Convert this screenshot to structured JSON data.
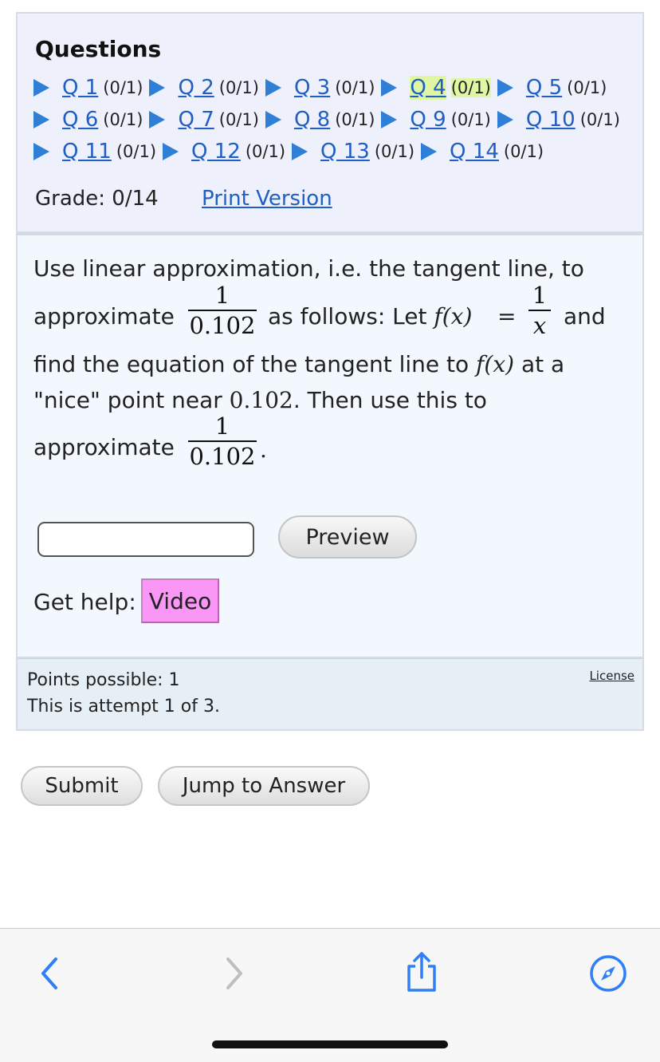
{
  "questions_panel": {
    "title": "Questions",
    "rows": [
      [
        {
          "label": "Q 1",
          "score": "(0/1)"
        },
        {
          "label": "Q 2",
          "score": "(0/1)"
        },
        {
          "label": "Q 3",
          "score": "(0/1)"
        },
        {
          "label": "Q 4",
          "score": "(0/1)",
          "current": true
        },
        {
          "label": "Q 5",
          "score": "(0/1)"
        }
      ],
      [
        {
          "label": "Q 6",
          "score": "(0/1)"
        },
        {
          "label": "Q 7",
          "score": "(0/1)"
        },
        {
          "label": "Q 8",
          "score": "(0/1)"
        },
        {
          "label": "Q 9",
          "score": "(0/1)"
        },
        {
          "label": "Q 10",
          "score": "(0/1)"
        }
      ],
      [
        {
          "label": "Q 11",
          "score": "(0/1)"
        },
        {
          "label": "Q 12",
          "score": "(0/1)"
        },
        {
          "label": "Q 13",
          "score": "(0/1)"
        },
        {
          "label": "Q 14",
          "score": "(0/1)"
        }
      ]
    ],
    "grade": "Grade: 0/14",
    "print_version": "Print Version"
  },
  "problem": {
    "line1": "Use linear approximation, i.e. the tangent line, to",
    "approximate": "approximate",
    "as_follows": "as follows: Let",
    "fx": "f(x)",
    "equals": "=",
    "and": "and",
    "line3a": "find the equation of the tangent line to",
    "line3b": "at a",
    "line4a": "\"nice\" point near",
    "near_value": "0.102",
    "line4b": ". Then use this to",
    "period": ".",
    "frac_num": "1",
    "frac_den": "0.102",
    "fx_frac_num": "1",
    "fx_frac_den": "x",
    "answer_value": "",
    "preview_label": "Preview",
    "help_label": "Get help:",
    "video_label": "Video"
  },
  "info": {
    "points": "Points possible: 1",
    "attempt": "This is attempt 1 of 3.",
    "license": "License"
  },
  "actions": {
    "submit": "Submit",
    "jump": "Jump to Answer"
  },
  "browser_toolbar": {
    "icons": [
      "back-icon",
      "forward-icon",
      "share-icon",
      "compass-icon"
    ],
    "accent": "#2f7ff6",
    "disabled": "#bfbfbf"
  },
  "colors": {
    "link": "#1f5fc4",
    "current_highlight": "#dff7a3",
    "video_button": "#fa96f5",
    "panel_bg": "#eef0fb",
    "problem_bg": "#f2f8fd"
  }
}
